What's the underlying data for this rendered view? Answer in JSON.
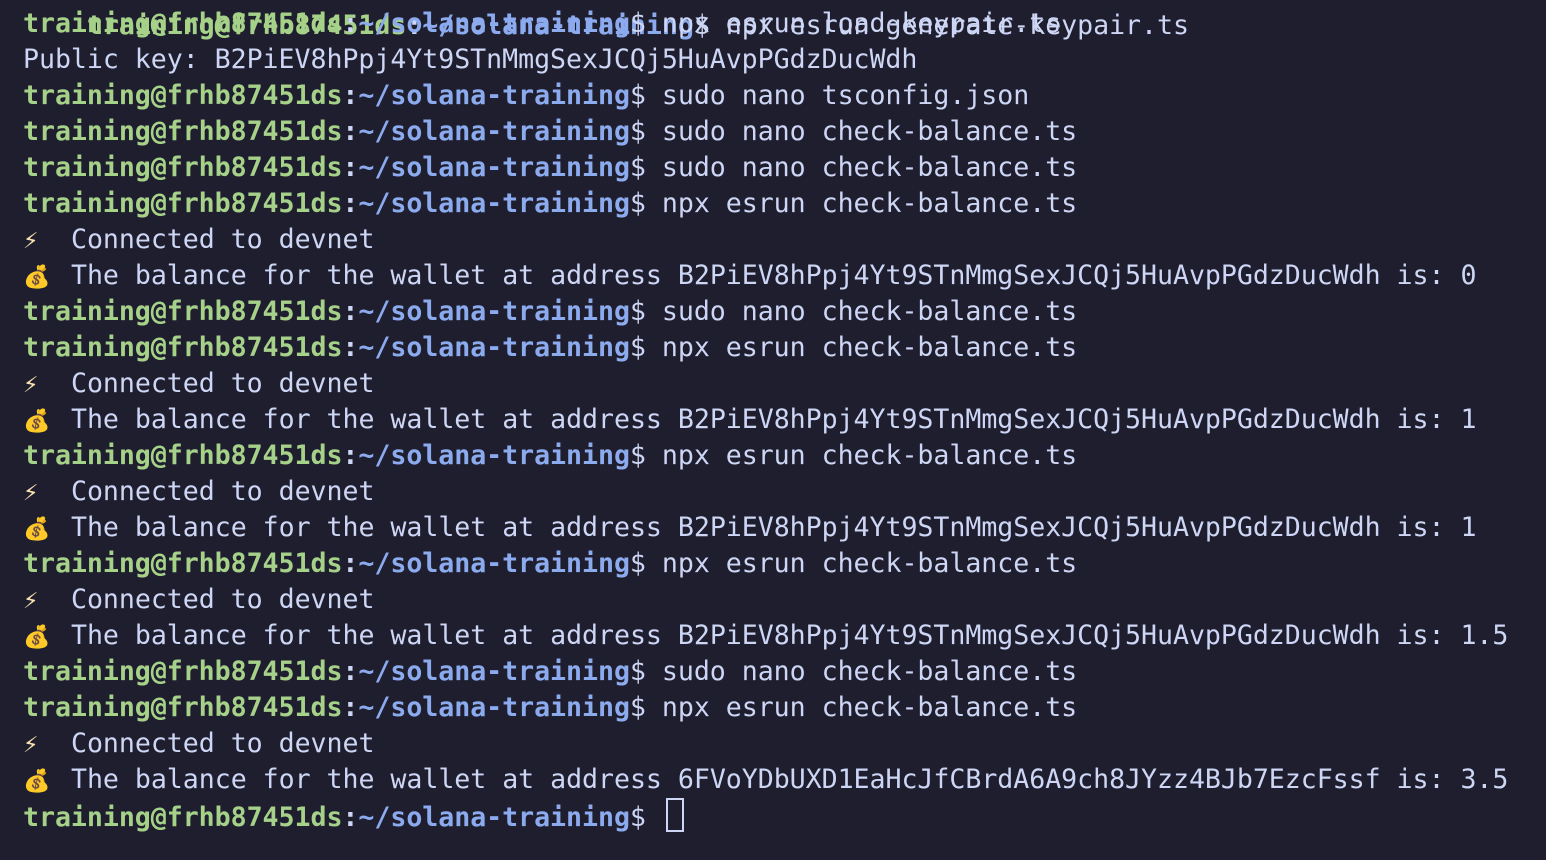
{
  "colors": {
    "background": "#1e1e2e",
    "user": "#a6d189",
    "path": "#8caaee",
    "text": "#cdd6f4"
  },
  "prompt": {
    "user_host": "training@frhb87451ds",
    "separator": ":",
    "path": "~/solana-training",
    "dollar": "$"
  },
  "top_fragment": {
    "user_host": "training@frhb87451ds",
    "separator": ":",
    "path": "~/solana-training",
    "dollar": "$",
    "cmd": "npx esrun generate-keypair.ts"
  },
  "lines": [
    {
      "kind": "cmd",
      "text": "npx esrun load-keypair.ts"
    },
    {
      "kind": "out",
      "text": "Public key: B2PiEV8hPpj4Yt9STnMmgSexJCQj5HuAvpPGdzDucWdh"
    },
    {
      "kind": "cmd",
      "text": "sudo nano tsconfig.json"
    },
    {
      "kind": "cmd",
      "text": "sudo nano check-balance.ts"
    },
    {
      "kind": "cmd",
      "text": "sudo nano check-balance.ts"
    },
    {
      "kind": "cmd",
      "text": "npx esrun check-balance.ts"
    },
    {
      "kind": "emoji",
      "icon": "bolt",
      "text": "Connected to devnet"
    },
    {
      "kind": "emoji",
      "icon": "money-bag",
      "text": "The balance for the wallet at address B2PiEV8hPpj4Yt9STnMmgSexJCQj5HuAvpPGdzDucWdh is: 0"
    },
    {
      "kind": "cmd",
      "text": "sudo nano check-balance.ts"
    },
    {
      "kind": "cmd",
      "text": "npx esrun check-balance.ts"
    },
    {
      "kind": "emoji",
      "icon": "bolt",
      "text": "Connected to devnet"
    },
    {
      "kind": "emoji",
      "icon": "money-bag",
      "text": "The balance for the wallet at address B2PiEV8hPpj4Yt9STnMmgSexJCQj5HuAvpPGdzDucWdh is: 1"
    },
    {
      "kind": "cmd",
      "text": "npx esrun check-balance.ts"
    },
    {
      "kind": "emoji",
      "icon": "bolt",
      "text": "Connected to devnet"
    },
    {
      "kind": "emoji",
      "icon": "money-bag",
      "text": "The balance for the wallet at address B2PiEV8hPpj4Yt9STnMmgSexJCQj5HuAvpPGdzDucWdh is: 1"
    },
    {
      "kind": "cmd",
      "text": "npx esrun check-balance.ts"
    },
    {
      "kind": "emoji",
      "icon": "bolt",
      "text": "Connected to devnet"
    },
    {
      "kind": "emoji",
      "icon": "money-bag",
      "text": "The balance for the wallet at address B2PiEV8hPpj4Yt9STnMmgSexJCQj5HuAvpPGdzDucWdh is: 1.5"
    },
    {
      "kind": "cmd",
      "text": "sudo nano check-balance.ts"
    },
    {
      "kind": "cmd",
      "text": "npx esrun check-balance.ts"
    },
    {
      "kind": "emoji",
      "icon": "bolt",
      "text": "Connected to devnet"
    },
    {
      "kind": "emoji",
      "icon": "money-bag",
      "text": "The balance for the wallet at address 6FVoYDbUXD1EaHcJfCBrdA6A9ch8JYzz4BJb7EzcFssf is: 3.5"
    },
    {
      "kind": "prompt",
      "text": ""
    }
  ],
  "icons": {
    "bolt": "⚡",
    "money-bag": "💰"
  }
}
